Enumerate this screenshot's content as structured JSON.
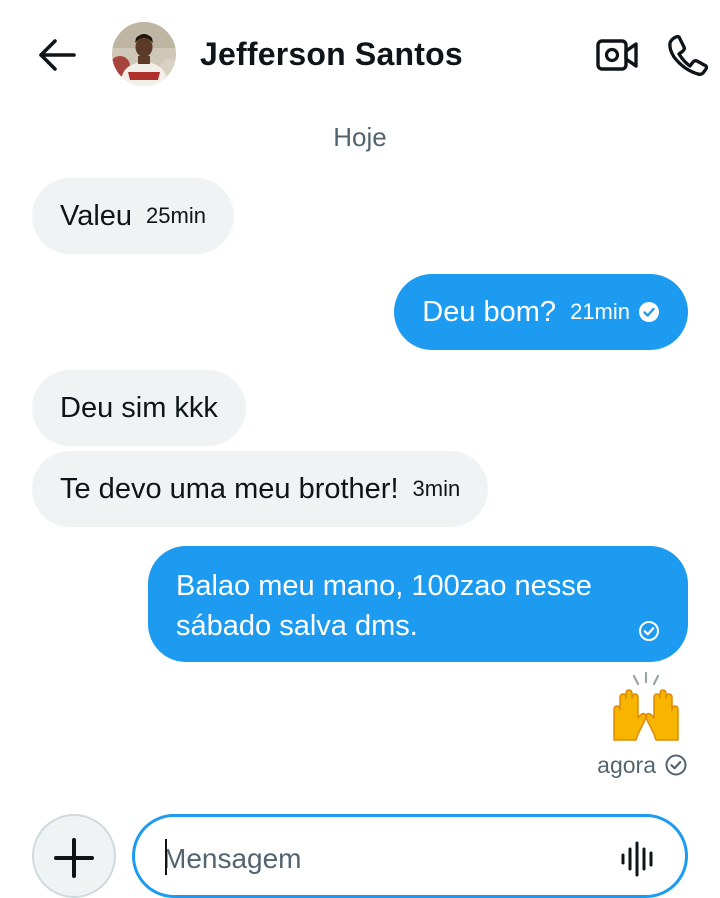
{
  "header": {
    "contact_name": "Jefferson Santos",
    "back_icon": "arrow-left-icon",
    "video_icon": "video-camera-icon",
    "call_icon": "phone-icon"
  },
  "conversation": {
    "day_separator": "Hoje",
    "messages": [
      {
        "direction": "incoming",
        "text": "Valeu",
        "time": "25min"
      },
      {
        "direction": "outgoing",
        "text": "Deu bom?",
        "time": "21min",
        "status_icon": "read-check-icon"
      },
      {
        "direction": "incoming",
        "text": "Deu sim kkk",
        "time": ""
      },
      {
        "direction": "incoming",
        "text": "Te devo uma meu brother!",
        "time": "3min"
      },
      {
        "direction": "outgoing",
        "text_lines": [
          "Balao meu mano, 100zao nesse",
          "sábado salva dms."
        ],
        "status_icon": "sent-check-icon"
      }
    ],
    "reaction": {
      "emoji": "🙌",
      "time": "agora",
      "status_icon": "sent-check-icon"
    }
  },
  "composer": {
    "placeholder": "Mensagem",
    "value": "",
    "add_icon": "plus-icon",
    "voice_icon": "voice-waveform-icon"
  },
  "colors": {
    "accent": "#1d9bf0",
    "incoming_bubble": "#eff3f4",
    "secondary_text": "#536471"
  }
}
